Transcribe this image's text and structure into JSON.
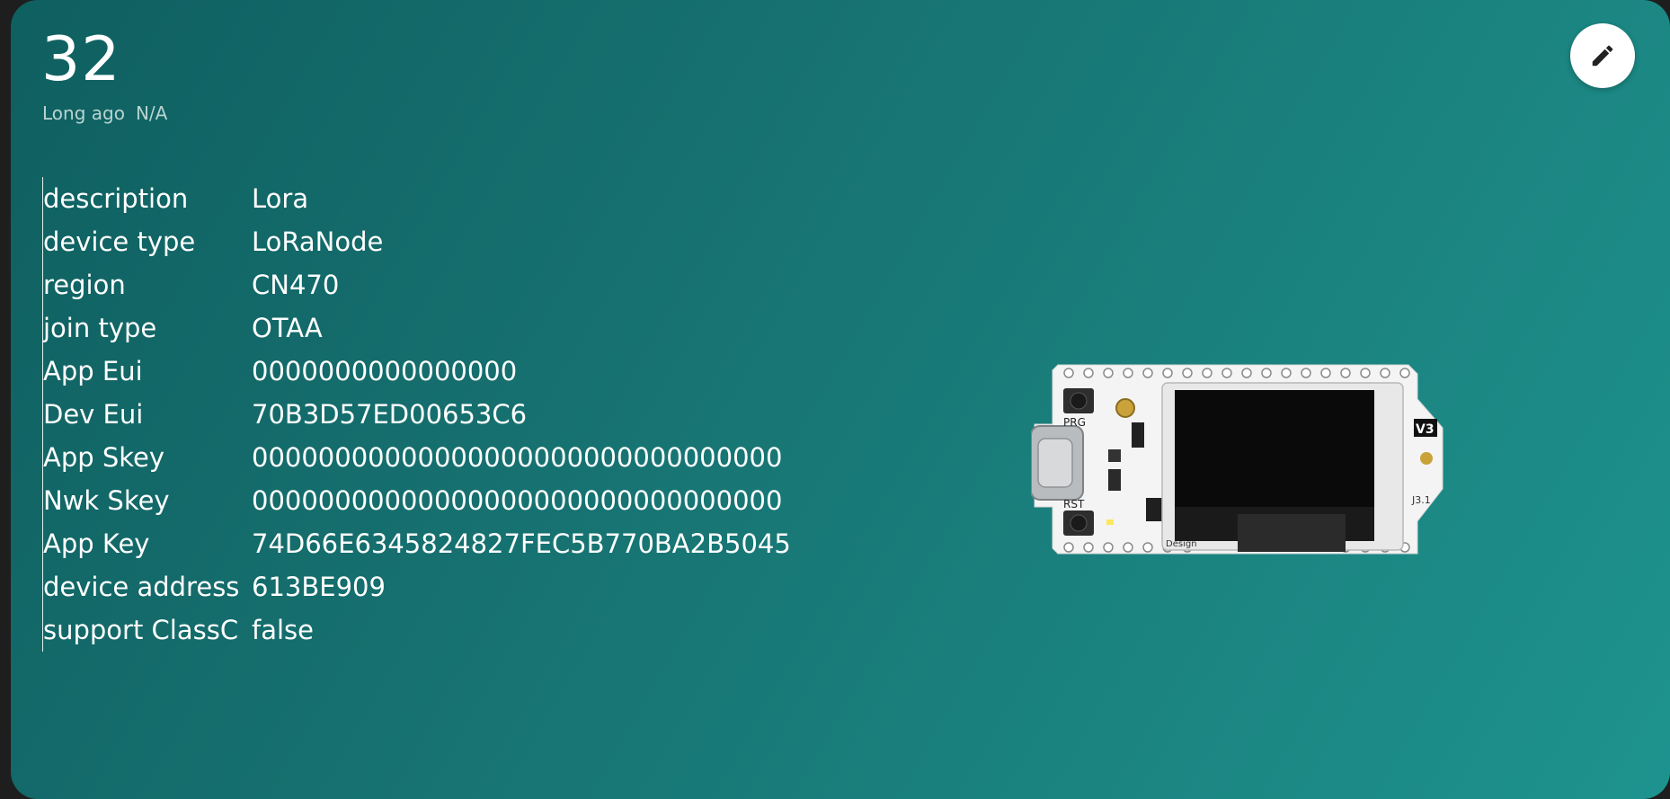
{
  "header": {
    "value": "32",
    "last_seen": "Long ago",
    "status": "N/A"
  },
  "edit": {
    "icon": "pencil-icon"
  },
  "properties": [
    {
      "key": "description",
      "value": "Lora"
    },
    {
      "key": "device type",
      "value": "LoRaNode"
    },
    {
      "key": "region",
      "value": "CN470"
    },
    {
      "key": "join type",
      "value": "OTAA"
    },
    {
      "key": "App Eui",
      "value": "0000000000000000"
    },
    {
      "key": "Dev Eui",
      "value": "70B3D57ED00653C6"
    },
    {
      "key": "App Skey",
      "value": "00000000000000000000000000000000"
    },
    {
      "key": "Nwk Skey",
      "value": "00000000000000000000000000000000"
    },
    {
      "key": "App Key",
      "value": "74D66E6345824827FEC5B770BA2B5045"
    },
    {
      "key": "device address",
      "value": "613BE909"
    },
    {
      "key": "support ClassC",
      "value": "false"
    }
  ],
  "image": {
    "board_labels": {
      "prg": "PRG",
      "rst": "RST",
      "version": "V3",
      "rev": "J3.1",
      "maker": "Design"
    }
  },
  "colors": {
    "card_gradient_start": "#0f5f60",
    "card_gradient_end": "#1e938e",
    "text": "#ffffff",
    "muted_text": "#b9d4d2"
  }
}
